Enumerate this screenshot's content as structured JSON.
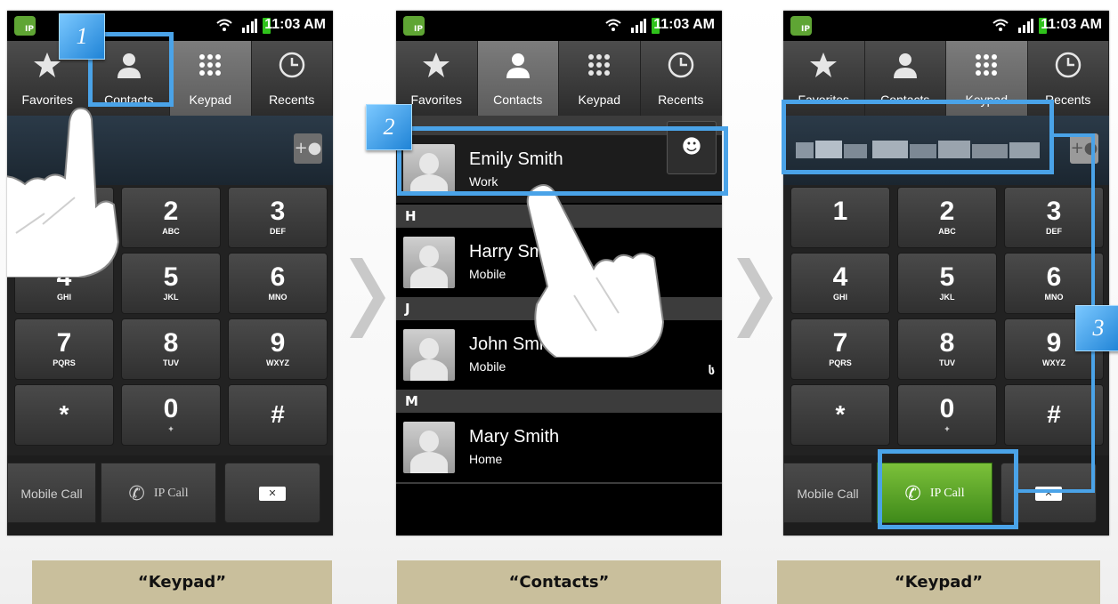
{
  "status_time": "11:03 AM",
  "app_icon_label": "IP",
  "tabs": [
    "Favorites",
    "Contacts",
    "Keypad",
    "Recents"
  ],
  "keys": [
    {
      "num": "1",
      "sub": ""
    },
    {
      "num": "2",
      "sub": "ABC"
    },
    {
      "num": "3",
      "sub": "DEF"
    },
    {
      "num": "4",
      "sub": "GHI"
    },
    {
      "num": "5",
      "sub": "JKL"
    },
    {
      "num": "6",
      "sub": "MNO"
    },
    {
      "num": "7",
      "sub": "PQRS"
    },
    {
      "num": "8",
      "sub": "TUV"
    },
    {
      "num": "9",
      "sub": "WXYZ"
    },
    {
      "num": "*",
      "sub": ""
    },
    {
      "num": "0",
      "sub": "+"
    },
    {
      "num": "#",
      "sub": ""
    }
  ],
  "mobile_call_label": "Mobile Call",
  "ip_call_label": "IP Call",
  "contacts": {
    "top_contact": {
      "name": "Emily  Smith",
      "type": "Work"
    },
    "sections": [
      {
        "letter": "H",
        "name": "Harry  Smith",
        "type": "Mobile"
      },
      {
        "letter": "J",
        "name": "John  Smith",
        "type": "Mobile"
      },
      {
        "letter": "M",
        "name": "Mary Smith",
        "type": "Home"
      }
    ],
    "ip_badge": "ს"
  },
  "steps": [
    "1",
    "2",
    "3"
  ],
  "captions": [
    "“Keypad”",
    "“Contacts”",
    "“Keypad”"
  ],
  "colors": {
    "highlight": "#4aa3e8",
    "caption_bg": "#c9bf9c",
    "ip_call_green": "#5aa82a"
  }
}
